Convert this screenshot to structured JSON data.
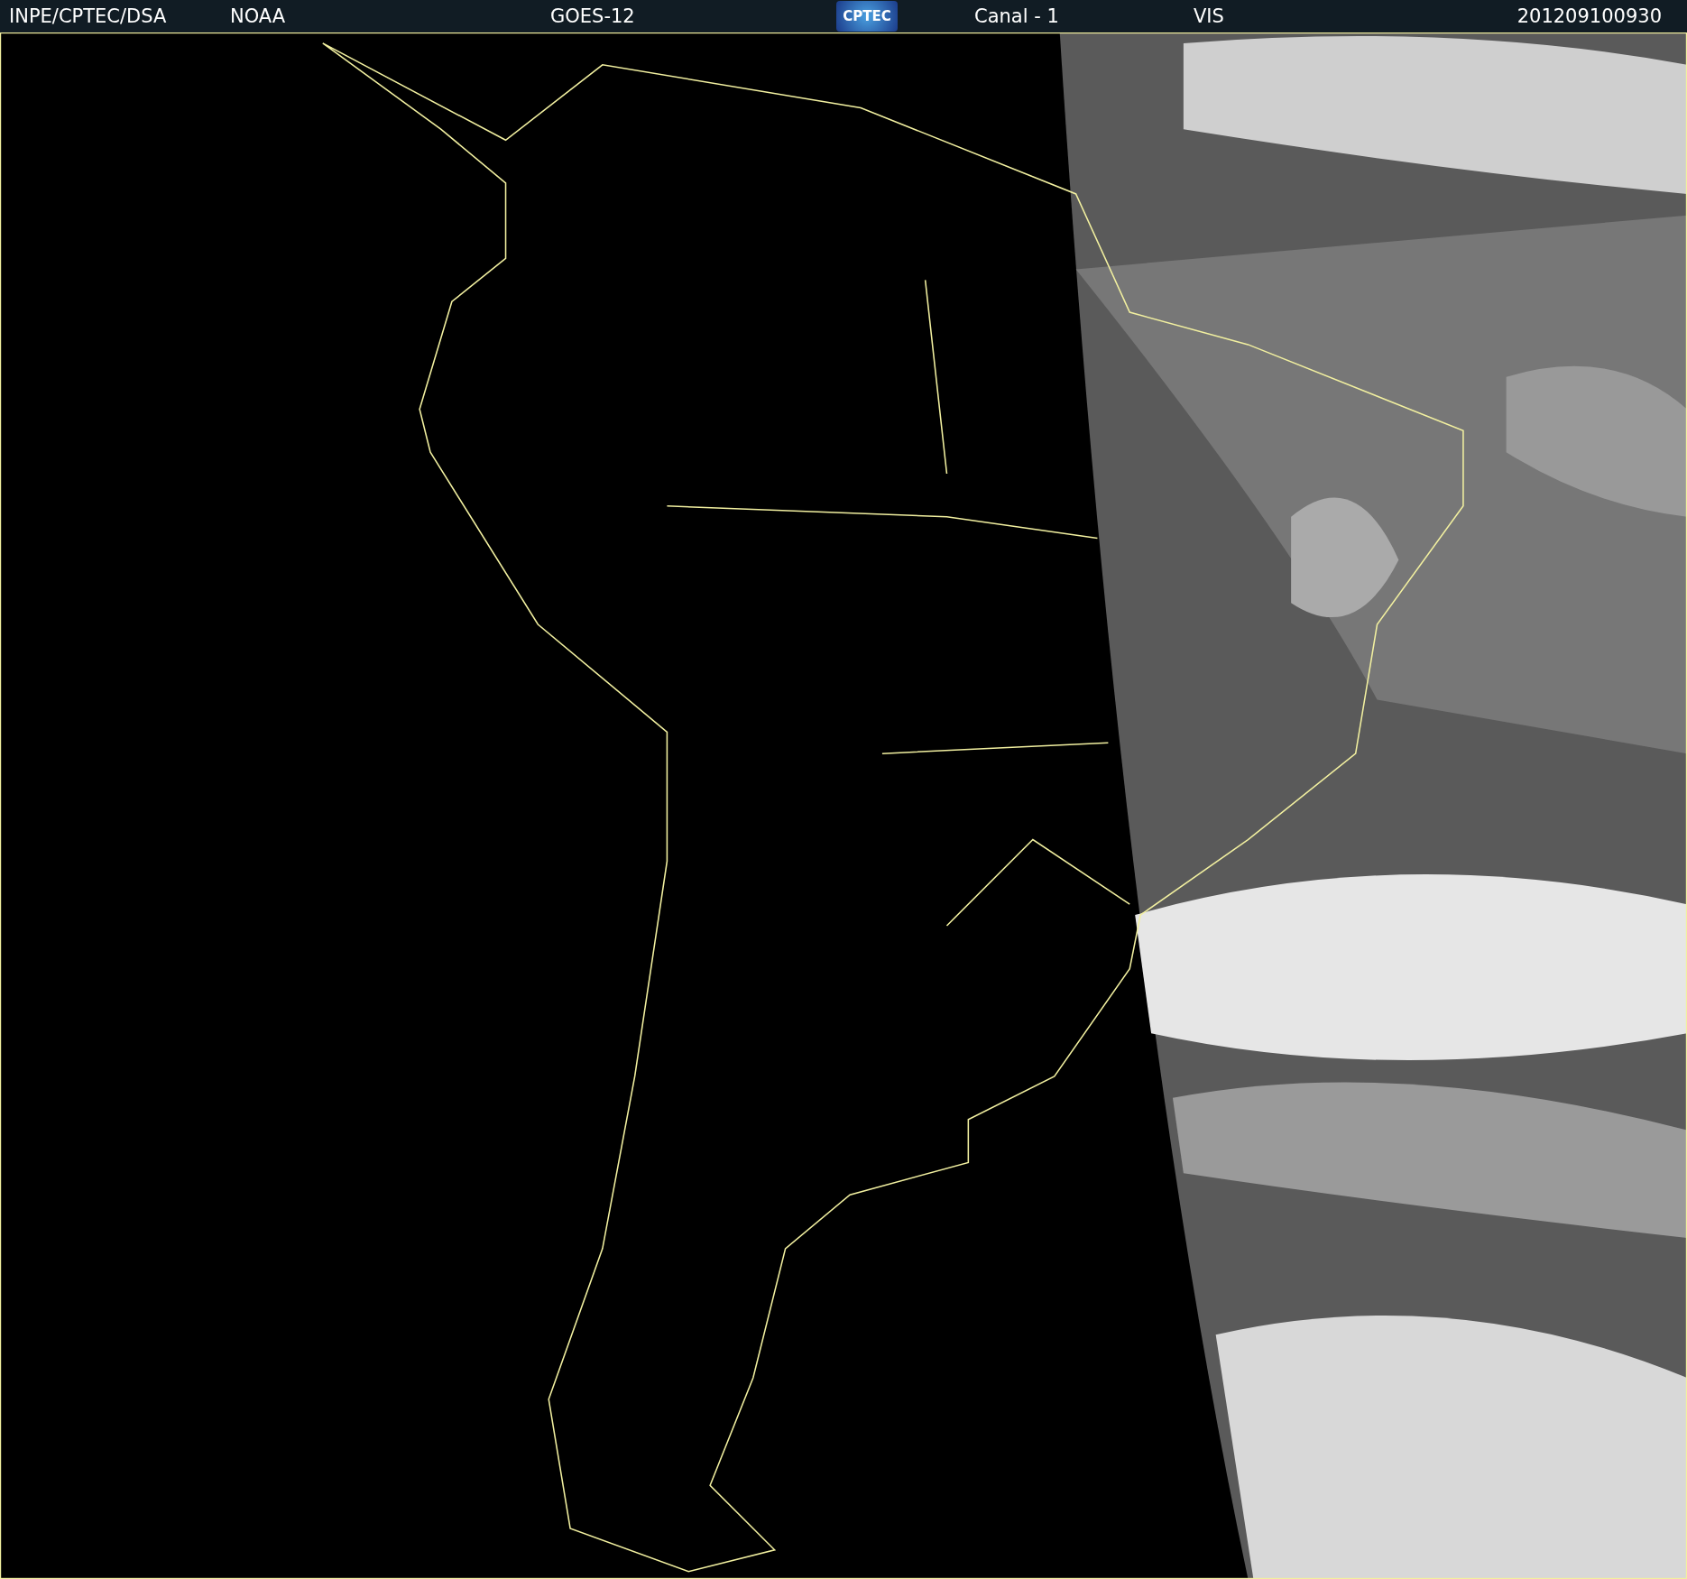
{
  "header": {
    "source": "INPE/CPTEC/DSA",
    "agency": "NOAA",
    "satellite": "GOES-12",
    "logo": "CPTEC",
    "channel": "Canal - 1",
    "band": "VIS",
    "timestamp": "201209100930"
  }
}
